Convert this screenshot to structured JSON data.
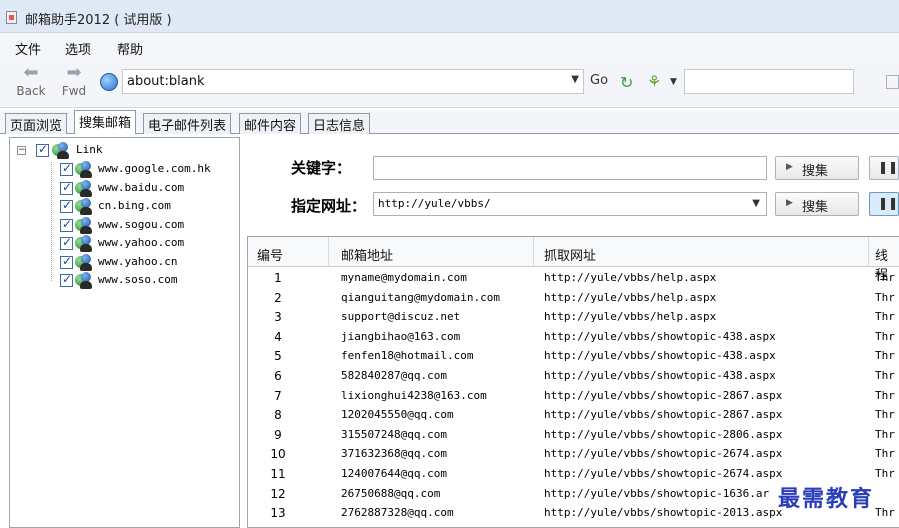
{
  "window": {
    "title": "邮箱助手2012 ( 试用版 )"
  },
  "menu": [
    "文件",
    "选项",
    "帮助"
  ],
  "toolbar": {
    "back_label": "Back",
    "fwd_label": "Fwd",
    "url": "about:blank",
    "go_label": "Go"
  },
  "tabs": [
    "页面浏览",
    "搜集邮箱",
    "电子邮件列表",
    "邮件内容",
    "日志信息"
  ],
  "active_tab": 1,
  "tree": {
    "root": "Link",
    "children": [
      "www.google.com.hk",
      "www.baidu.com",
      "cn.bing.com",
      "www.sogou.com",
      "www.yahoo.com",
      "www.yahoo.cn",
      "www.soso.com"
    ]
  },
  "search": {
    "keyword_label": "关键字：",
    "keyword_value": "",
    "site_label": "指定网址：",
    "site_value": "http://yule/vbbs/",
    "search_button": "搜集"
  },
  "table": {
    "columns": [
      "编号",
      "邮箱地址",
      "抓取网址",
      "线程"
    ],
    "rows": [
      {
        "id": "1",
        "email": "myname@mydomain.com",
        "url": "http://yule/vbbs/help.aspx",
        "thread": "Thr"
      },
      {
        "id": "2",
        "email": "qianguitang@mydomain.com",
        "url": "http://yule/vbbs/help.aspx",
        "thread": "Thr"
      },
      {
        "id": "3",
        "email": "support@discuz.net",
        "url": "http://yule/vbbs/help.aspx",
        "thread": "Thr"
      },
      {
        "id": "4",
        "email": "jiangbihao@163.com",
        "url": "http://yule/vbbs/showtopic-438.aspx",
        "thread": "Thr"
      },
      {
        "id": "5",
        "email": "fenfen18@hotmail.com",
        "url": "http://yule/vbbs/showtopic-438.aspx",
        "thread": "Thr"
      },
      {
        "id": "6",
        "email": "582840287@qq.com",
        "url": "http://yule/vbbs/showtopic-438.aspx",
        "thread": "Thr"
      },
      {
        "id": "7",
        "email": "lixionghui4238@163.com",
        "url": "http://yule/vbbs/showtopic-2867.aspx",
        "thread": "Thr"
      },
      {
        "id": "8",
        "email": "1202045550@qq.com",
        "url": "http://yule/vbbs/showtopic-2867.aspx",
        "thread": "Thr"
      },
      {
        "id": "9",
        "email": "315507248@qq.com",
        "url": "http://yule/vbbs/showtopic-2806.aspx",
        "thread": "Thr"
      },
      {
        "id": "10",
        "email": "371632368@qq.com",
        "url": "http://yule/vbbs/showtopic-2674.aspx",
        "thread": "Thr"
      },
      {
        "id": "11",
        "email": "124007644@qq.com",
        "url": "http://yule/vbbs/showtopic-2674.aspx",
        "thread": "Thr"
      },
      {
        "id": "12",
        "email": "26750688@qq.com",
        "url": "http://yule/vbbs/showtopic-1636.ar",
        "thread": ""
      },
      {
        "id": "13",
        "email": "2762887328@qq.com",
        "url": "http://yule/vbbs/showtopic-2013.aspx",
        "thread": "Thr"
      }
    ]
  },
  "watermark": "最需教育"
}
